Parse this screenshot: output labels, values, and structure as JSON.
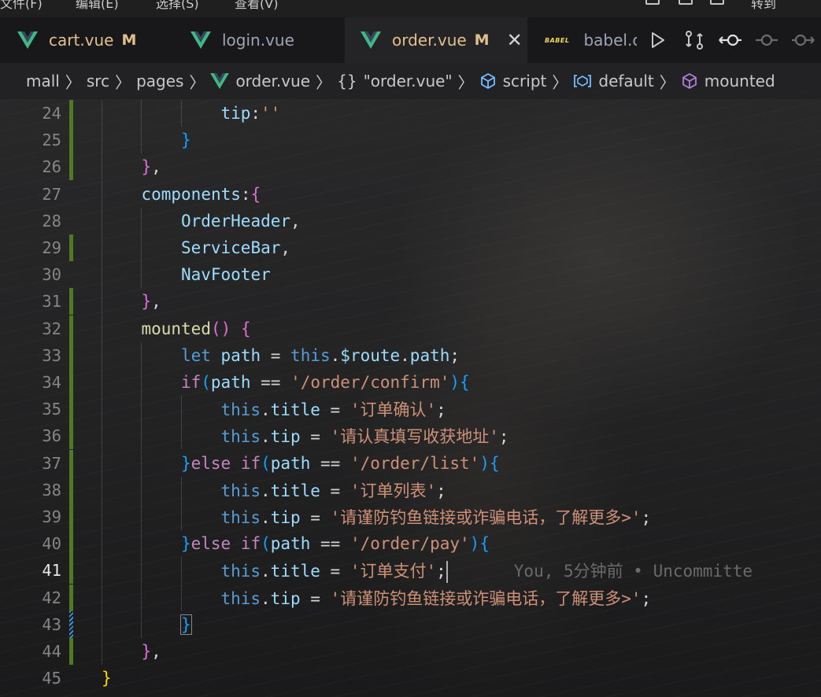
{
  "menubar": {
    "items": [
      "文件(F)",
      "编辑(E)",
      "选择(S)",
      "查看(V)"
    ],
    "go_label": "转到"
  },
  "tabs": [
    {
      "label": "cart.vue",
      "status": "M",
      "modified": true,
      "icon": "vue-icon"
    },
    {
      "label": "login.vue",
      "status": "",
      "modified": false,
      "icon": "vue-icon"
    },
    {
      "label": "order.vue",
      "status": "M",
      "modified": true,
      "icon": "vue-icon",
      "active": true
    },
    {
      "label": "babel.c",
      "status": "",
      "modified": false,
      "icon": "babel-icon"
    }
  ],
  "tab_actions": [
    "run-icon",
    "compare-changes-icon",
    "go-back-change-icon",
    "timeline-icon",
    "go-forward-change-icon"
  ],
  "breadcrumb": {
    "items": [
      "mall",
      "src",
      "pages",
      "order.vue",
      "\"order.vue\"",
      "script",
      "default",
      "mounted"
    ]
  },
  "editor": {
    "current_line": 41,
    "blame": "You, 5分钟前 • Uncommitte",
    "lines": [
      {
        "n": "24",
        "code": [
          [
            "tip",
            "t-prop"
          ],
          [
            ":",
            "t-punc"
          ],
          [
            "''",
            "t-str"
          ]
        ]
      },
      {
        "n": "25",
        "code": [
          [
            "}",
            "t-bracket3"
          ]
        ]
      },
      {
        "n": "26",
        "code": [
          [
            "}",
            "t-bracket2"
          ],
          [
            ",",
            "t-punc"
          ]
        ]
      },
      {
        "n": "27",
        "code": [
          [
            "components",
            "t-prop"
          ],
          [
            ":",
            "t-punc"
          ],
          [
            "{",
            "t-bracket2"
          ]
        ]
      },
      {
        "n": "28",
        "code": [
          [
            "OrderHeader",
            "t-ident"
          ],
          [
            ",",
            "t-punc"
          ]
        ]
      },
      {
        "n": "29",
        "code": [
          [
            "ServiceBar",
            "t-ident"
          ],
          [
            ",",
            "t-punc"
          ]
        ]
      },
      {
        "n": "30",
        "code": [
          [
            "NavFooter",
            "t-ident"
          ]
        ]
      },
      {
        "n": "31",
        "code": [
          [
            "}",
            "t-bracket2"
          ],
          [
            ",",
            "t-punc"
          ]
        ]
      },
      {
        "n": "32",
        "code": [
          [
            "mounted",
            "t-fn"
          ],
          [
            "()",
            "t-bracket2"
          ],
          [
            " ",
            "t-punc"
          ],
          [
            "{",
            "t-bracket2"
          ]
        ]
      },
      {
        "n": "33",
        "code": [
          [
            "let",
            "t-kw"
          ],
          [
            " path ",
            "t-ident"
          ],
          [
            "= ",
            "t-punc"
          ],
          [
            "this",
            "t-kw"
          ],
          [
            ".",
            "t-punc"
          ],
          [
            "$route",
            "t-ident"
          ],
          [
            ".",
            "t-punc"
          ],
          [
            "path",
            "t-ident"
          ],
          [
            ";",
            "t-punc"
          ]
        ]
      },
      {
        "n": "34",
        "code": [
          [
            "if",
            "t-ctrl"
          ],
          [
            "(",
            "t-bracket3"
          ],
          [
            "path ",
            "t-ident"
          ],
          [
            "== ",
            "t-punc"
          ],
          [
            "'/order/confirm'",
            "t-str"
          ],
          [
            ")",
            "t-bracket3"
          ],
          [
            "{",
            "t-bracket3"
          ]
        ]
      },
      {
        "n": "35",
        "code": [
          [
            "this",
            "t-kw"
          ],
          [
            ".",
            "t-punc"
          ],
          [
            "title",
            "t-ident"
          ],
          [
            " = ",
            "t-punc"
          ],
          [
            "'订单确认'",
            "t-str"
          ],
          [
            ";",
            "t-punc"
          ]
        ]
      },
      {
        "n": "36",
        "code": [
          [
            "this",
            "t-kw"
          ],
          [
            ".",
            "t-punc"
          ],
          [
            "tip",
            "t-ident"
          ],
          [
            " = ",
            "t-punc"
          ],
          [
            "'请认真填写收获地址'",
            "t-str"
          ],
          [
            ";",
            "t-punc"
          ]
        ]
      },
      {
        "n": "37",
        "code": [
          [
            "}",
            "t-bracket3"
          ],
          [
            "else ",
            "t-ctrl"
          ],
          [
            "if",
            "t-ctrl"
          ],
          [
            "(",
            "t-bracket3"
          ],
          [
            "path ",
            "t-ident"
          ],
          [
            "== ",
            "t-punc"
          ],
          [
            "'/order/list'",
            "t-str"
          ],
          [
            ")",
            "t-bracket3"
          ],
          [
            "{",
            "t-bracket3"
          ]
        ]
      },
      {
        "n": "38",
        "code": [
          [
            "this",
            "t-kw"
          ],
          [
            ".",
            "t-punc"
          ],
          [
            "title",
            "t-ident"
          ],
          [
            " = ",
            "t-punc"
          ],
          [
            "'订单列表'",
            "t-str"
          ],
          [
            ";",
            "t-punc"
          ]
        ]
      },
      {
        "n": "39",
        "code": [
          [
            "this",
            "t-kw"
          ],
          [
            ".",
            "t-punc"
          ],
          [
            "tip",
            "t-ident"
          ],
          [
            " = ",
            "t-punc"
          ],
          [
            "'请谨防钓鱼链接或诈骗电话，了解更多>'",
            "t-str"
          ],
          [
            ";",
            "t-punc"
          ]
        ]
      },
      {
        "n": "40",
        "code": [
          [
            "}",
            "t-bracket3"
          ],
          [
            "else ",
            "t-ctrl"
          ],
          [
            "if",
            "t-ctrl"
          ],
          [
            "(",
            "t-bracket3"
          ],
          [
            "path ",
            "t-ident"
          ],
          [
            "== ",
            "t-punc"
          ],
          [
            "'/order/pay'",
            "t-str"
          ],
          [
            ")",
            "t-bracket3"
          ],
          [
            "{",
            "t-bracket3"
          ]
        ]
      },
      {
        "n": "41",
        "code": [
          [
            "this",
            "t-kw"
          ],
          [
            ".",
            "t-punc"
          ],
          [
            "title",
            "t-ident"
          ],
          [
            " = ",
            "t-punc"
          ],
          [
            "'订单支付'",
            "t-str"
          ],
          [
            ";",
            "t-punc"
          ]
        ]
      },
      {
        "n": "42",
        "code": [
          [
            "this",
            "t-kw"
          ],
          [
            ".",
            "t-punc"
          ],
          [
            "tip",
            "t-ident"
          ],
          [
            " = ",
            "t-punc"
          ],
          [
            "'请谨防钓鱼链接或诈骗电话，了解更多>'",
            "t-str"
          ],
          [
            ";",
            "t-punc"
          ]
        ]
      },
      {
        "n": "43",
        "code": [
          [
            "}",
            "t-bracket3"
          ]
        ]
      },
      {
        "n": "44",
        "code": [
          [
            "}",
            "t-bracket2"
          ],
          [
            ",",
            "t-punc"
          ]
        ]
      },
      {
        "n": "45",
        "code": [
          [
            "}",
            "t-bracket1"
          ]
        ]
      }
    ]
  }
}
